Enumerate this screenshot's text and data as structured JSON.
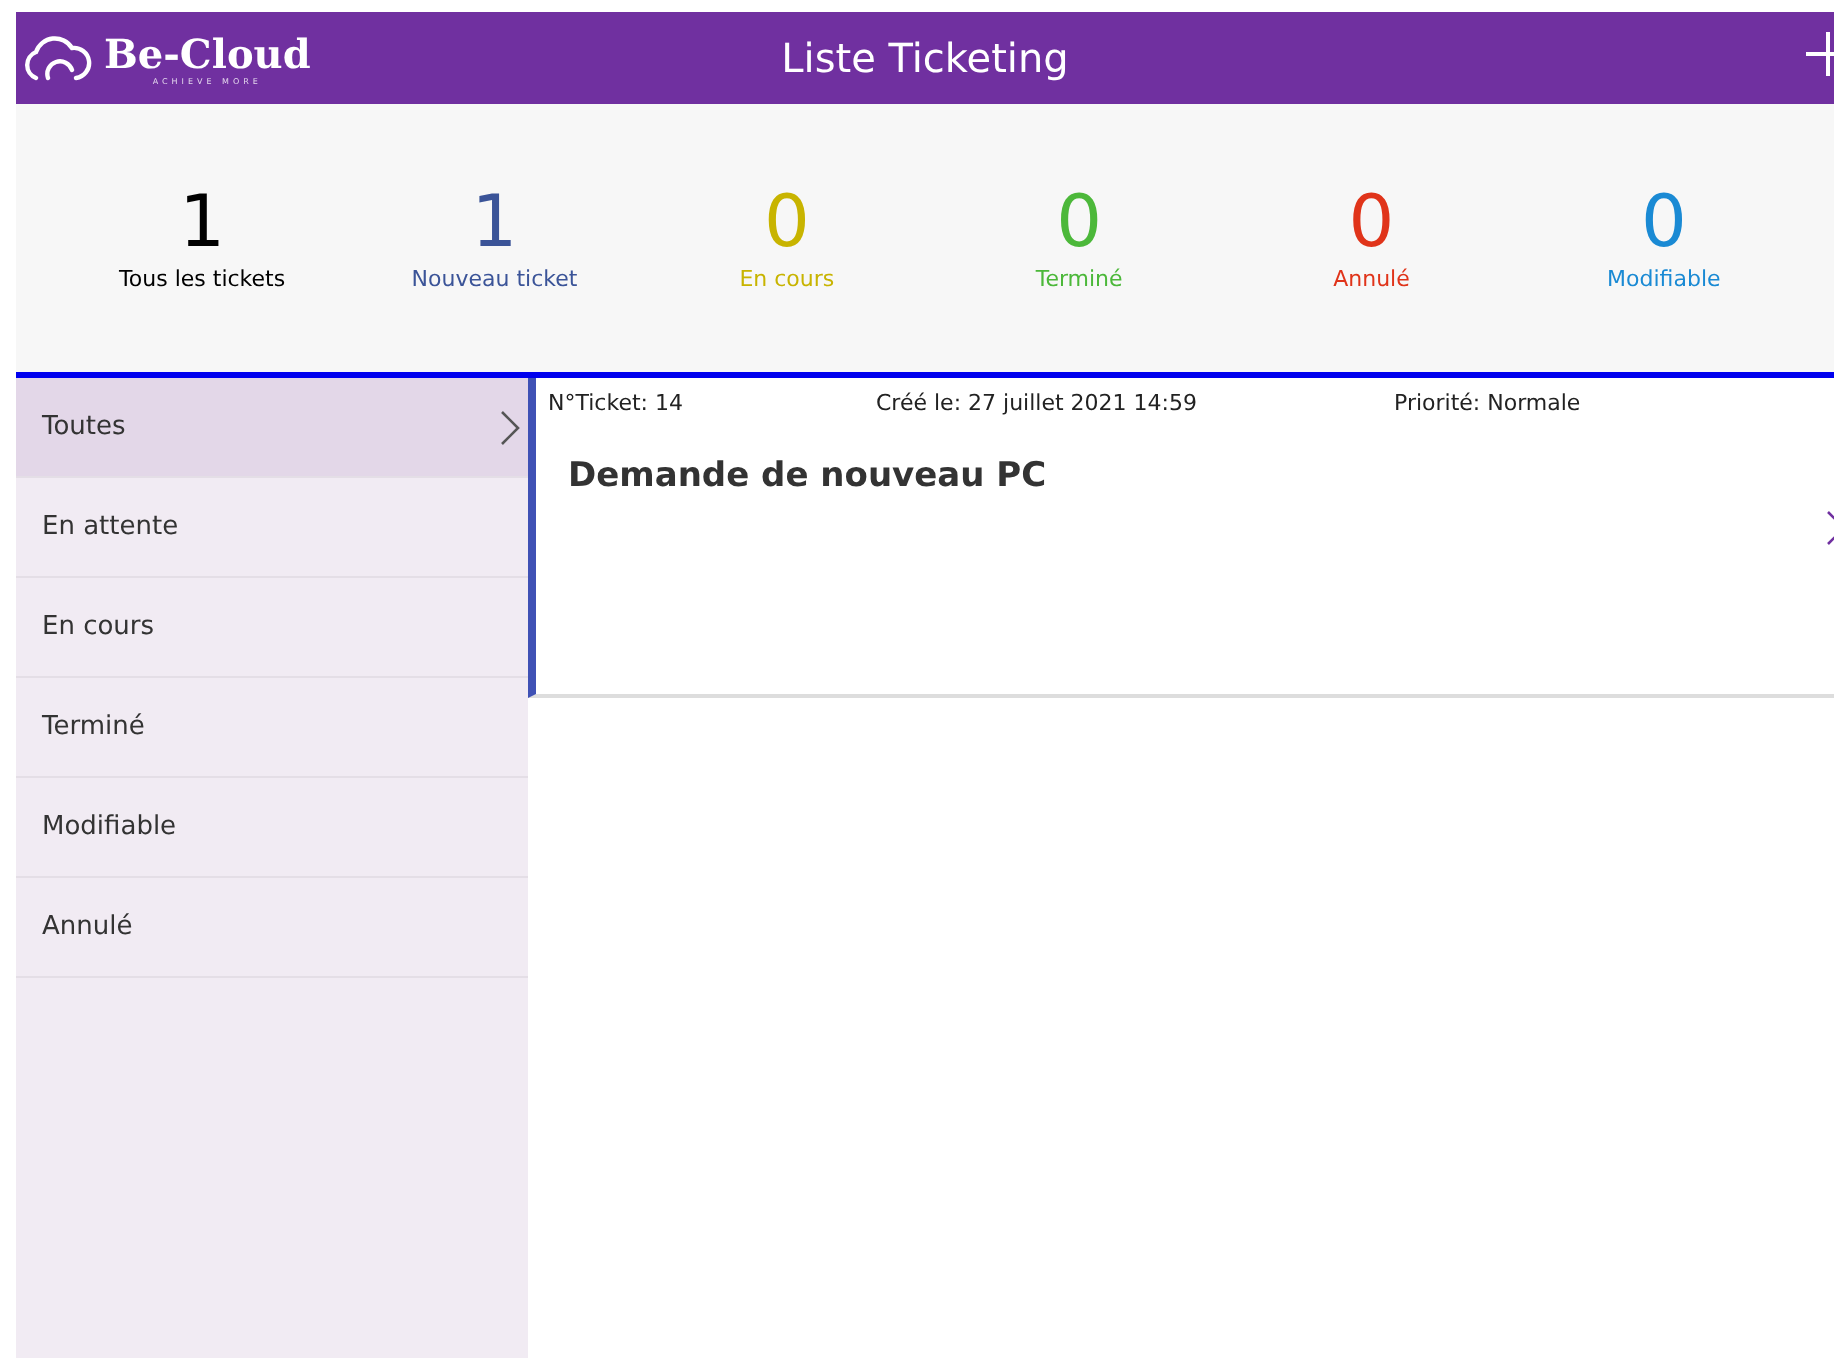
{
  "header": {
    "brand": "Be-Cloud",
    "tagline": "ACHIEVE MORE",
    "title": "Liste Ticketing"
  },
  "stats": [
    {
      "count": "1",
      "label": "Tous les tickets",
      "color": "#000000"
    },
    {
      "count": "1",
      "label": "Nouveau ticket",
      "color": "#3b5498"
    },
    {
      "count": "0",
      "label": "En cours",
      "color": "#c8b400"
    },
    {
      "count": "0",
      "label": "Terminé",
      "color": "#4cb83a"
    },
    {
      "count": "0",
      "label": "Annulé",
      "color": "#e0341a"
    },
    {
      "count": "0",
      "label": "Modifiable",
      "color": "#1a8ad4"
    }
  ],
  "sidebar": {
    "items": [
      {
        "label": "Toutes",
        "selected": true
      },
      {
        "label": "En attente",
        "selected": false
      },
      {
        "label": "En cours",
        "selected": false
      },
      {
        "label": "Terminé",
        "selected": false
      },
      {
        "label": "Modifiable",
        "selected": false
      },
      {
        "label": "Annulé",
        "selected": false
      }
    ]
  },
  "tickets": [
    {
      "number": "N°Ticket: 14",
      "created": "Créé le: 27 juillet 2021 14:59",
      "priority": "Priorité: Normale",
      "title": "Demande de nouveau PC"
    }
  ]
}
